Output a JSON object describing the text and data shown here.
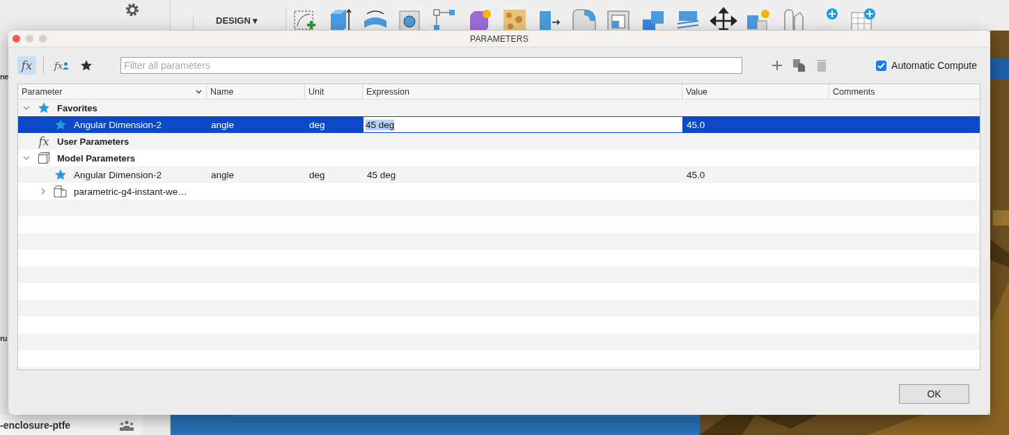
{
  "app": {
    "sidebar_fragments": [
      {
        "text": "ne"
      },
      {
        "text": "ru"
      }
    ],
    "workspace_menu": "DESIGN ▾",
    "project_name": "-enclosure-ptfe"
  },
  "dialog": {
    "title": "PARAMETERS",
    "filters": [
      {
        "kind": "all",
        "symbol": "fx",
        "selected": true
      },
      {
        "kind": "user",
        "symbol": "fx",
        "selected": false
      },
      {
        "kind": "favorites",
        "selected": false
      }
    ],
    "search": {
      "placeholder": "Filter all parameters"
    },
    "automatic_compute": {
      "label": "Automatic Compute",
      "checked": true
    },
    "columns": [
      "Parameter",
      "Name",
      "Unit",
      "Expression",
      "Value",
      "Comments"
    ],
    "rows": [
      {
        "kind": "favorites",
        "label": "Favorites",
        "expanded": true,
        "children": [
          {
            "kind": "param",
            "favorite": true,
            "selected": true,
            "parameter": "Angular Dimension-2",
            "name": "angle",
            "unit": "deg",
            "expression": "45 deg",
            "value": "45.0"
          }
        ]
      },
      {
        "kind": "user",
        "symbol": "fx",
        "label": "User Parameters"
      },
      {
        "kind": "model",
        "label": "Model Parameters",
        "expanded": true,
        "children": [
          {
            "kind": "param",
            "favorite": true,
            "selected": false,
            "parameter": "Angular Dimension-2",
            "name": "angle",
            "unit": "deg",
            "expression": "45 deg",
            "value": "45.0"
          },
          {
            "kind": "component",
            "label": "parametric-g4-instant-we…",
            "expanded": false
          }
        ]
      }
    ],
    "buttons": [
      "OK"
    ]
  }
}
